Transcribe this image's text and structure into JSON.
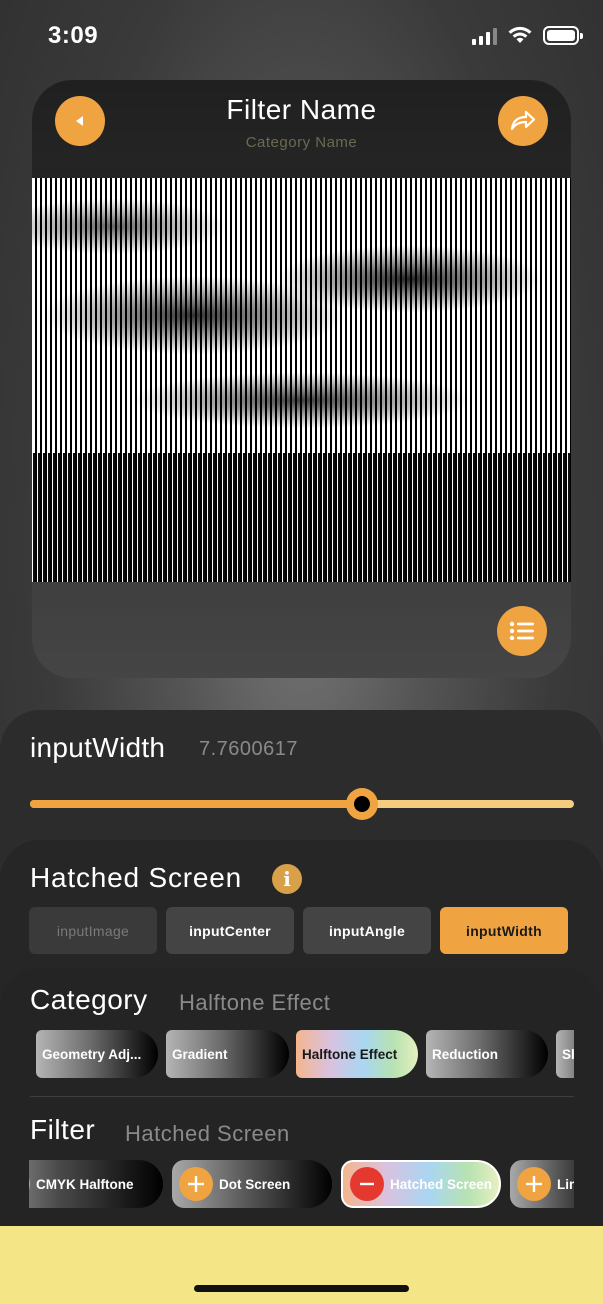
{
  "status": {
    "time": "3:09"
  },
  "header": {
    "title": "Filter Name",
    "subtitle": "Category Name",
    "back_icon": "back-triangle-icon",
    "share_icon": "share-arrow-icon",
    "menu_icon": "list-icon"
  },
  "slider": {
    "param_name": "inputWidth",
    "value": "7.7600617",
    "fill_fraction": 0.61
  },
  "inputs": {
    "filter_name": "Hatched Screen",
    "tabs": [
      {
        "label": "inputImage",
        "state": "disabled"
      },
      {
        "label": "inputCenter",
        "state": "normal"
      },
      {
        "label": "inputAngle",
        "state": "normal"
      },
      {
        "label": "inputWidth",
        "state": "active"
      }
    ]
  },
  "category": {
    "label": "Category",
    "current": "Halftone Effect",
    "chips": [
      {
        "label": "Geometry Adj...",
        "selected": false
      },
      {
        "label": "Gradient",
        "selected": false
      },
      {
        "label": "Halftone Effect",
        "selected": true
      },
      {
        "label": "Reduction",
        "selected": false
      },
      {
        "label": "Sh",
        "selected": false
      }
    ]
  },
  "filter": {
    "label": "Filter",
    "current": "Hatched Screen",
    "chips": [
      {
        "label": "CMYK Halftone",
        "action": "plus",
        "selected": false
      },
      {
        "label": "Dot Screen",
        "action": "plus",
        "selected": false
      },
      {
        "label": "Hatched Screen",
        "action": "minus",
        "selected": true
      },
      {
        "label": "Lin",
        "action": "plus",
        "selected": false
      }
    ]
  },
  "colors": {
    "accent": "#f0a441",
    "remove": "#e5382f",
    "bottom_bar": "#f4e686"
  }
}
